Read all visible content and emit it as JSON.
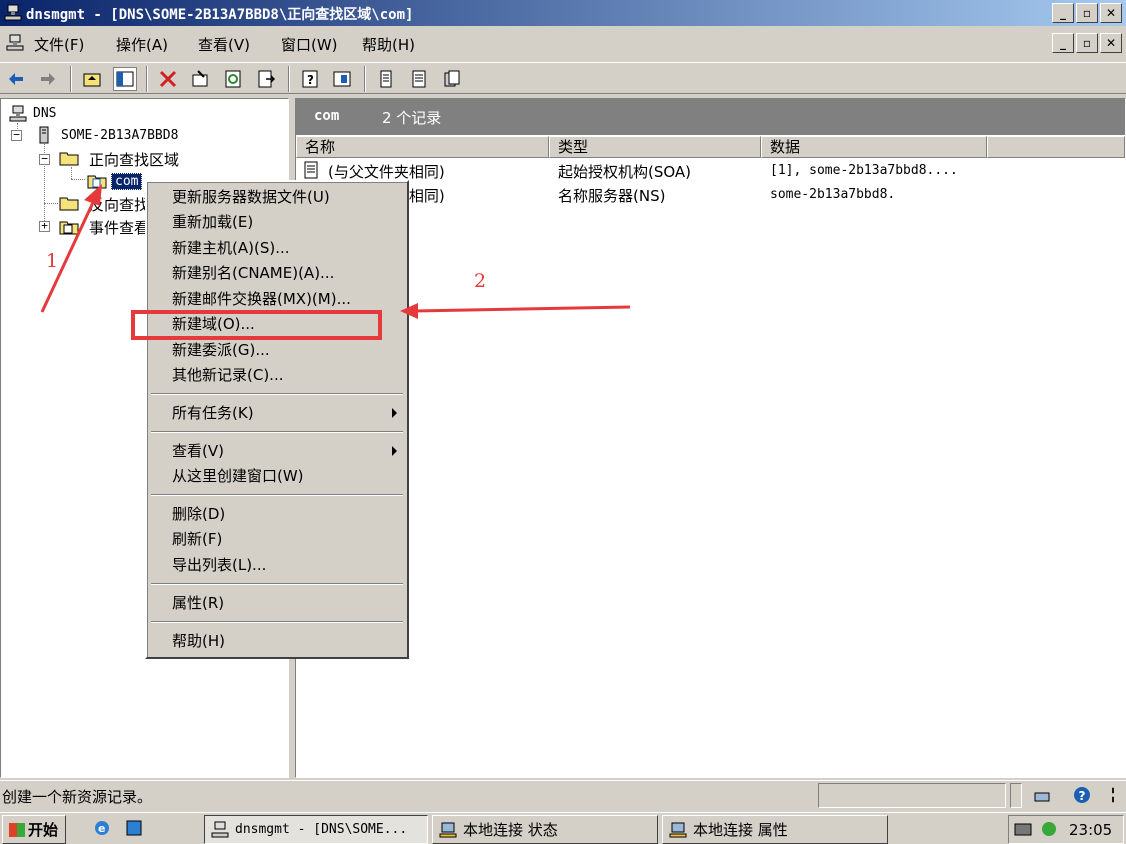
{
  "window": {
    "title": "dnsmgmt - [DNS\\SOME-2B13A7BBD8\\正向查找区域\\com]",
    "buttons": [
      "_",
      "▫",
      "✕"
    ]
  },
  "menubar": {
    "items": [
      "文件(F)",
      "操作(A)",
      "查看(V)",
      "窗口(W)",
      "帮助(H)"
    ]
  },
  "tree": {
    "root": "DNS",
    "server": "SOME-2B13A7BBD8",
    "forward_zones": "正向查找区域",
    "com": "com",
    "reverse_zones": "反向查找区域",
    "event_viewer": "事件查看器"
  },
  "result_pane": {
    "header_title": "com",
    "header_count": "2 个记录",
    "columns": [
      "名称",
      "类型",
      "数据"
    ],
    "rows": [
      {
        "name": "(与父文件夹相同)",
        "type": "起始授权机构(SOA)",
        "data": "[1], some-2b13a7bbd8...."
      },
      {
        "name": "(与父文件夹相同)",
        "type": "名称服务器(NS)",
        "data": "some-2b13a7bbd8."
      }
    ]
  },
  "context_menu": {
    "items": [
      "更新服务器数据文件(U)",
      "重新加载(E)",
      "新建主机(A)(S)...",
      "新建别名(CNAME)(A)...",
      "新建邮件交换器(MX)(M)...",
      "新建域(O)...",
      "新建委派(G)...",
      "其他新记录(C)...",
      "所有任务(K)",
      "查看(V)",
      "从这里创建窗口(W)",
      "删除(D)",
      "刷新(F)",
      "导出列表(L)...",
      "属性(R)",
      "帮助(H)"
    ]
  },
  "annotations": {
    "label1": "1",
    "label2": "2",
    "color": "#e6393c"
  },
  "status": {
    "text": "创建一个新资源记录。"
  },
  "taskbar": {
    "start": "开始",
    "tasks": [
      "dnsmgmt - [DNS\\SOME...",
      "本地连接 状态",
      "本地连接 属性"
    ],
    "clock": "23:05"
  }
}
